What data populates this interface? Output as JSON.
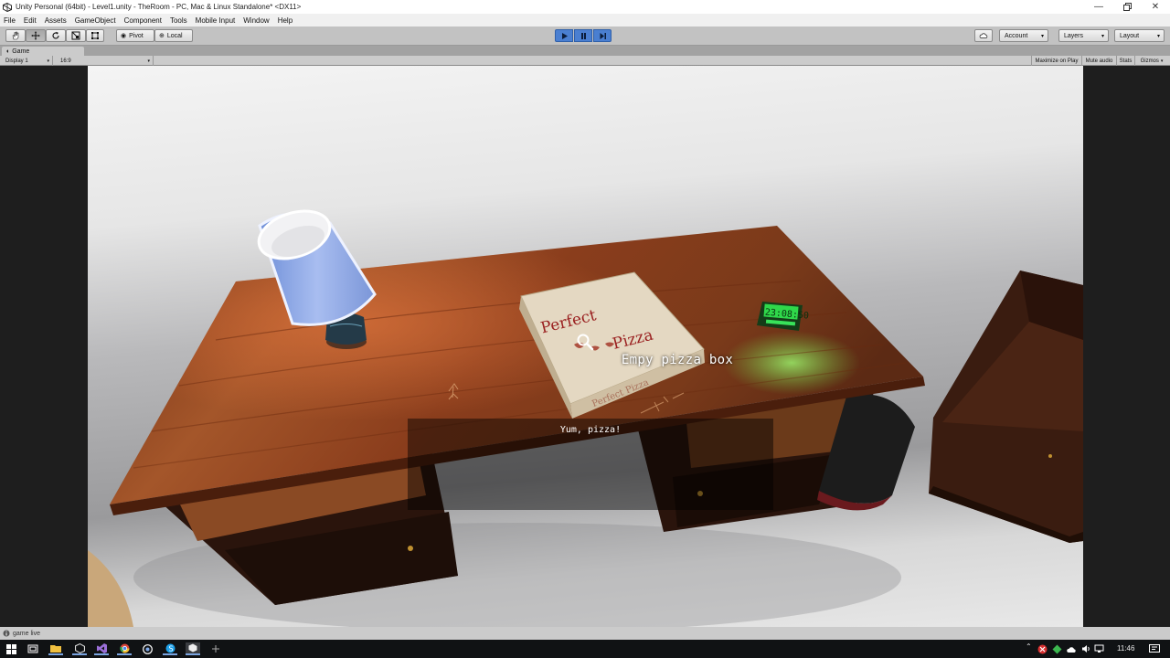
{
  "window": {
    "title": "Unity Personal (64bit) - Level1.unity - TheRoom - PC, Mac & Linux Standalone* <DX11>",
    "controls": [
      "minimize-icon",
      "restore-icon",
      "close-icon"
    ]
  },
  "menu": [
    "File",
    "Edit",
    "Assets",
    "GameObject",
    "Component",
    "Tools",
    "Mobile Input",
    "Window",
    "Help"
  ],
  "toolbar": {
    "tools": [
      "hand-tool-icon",
      "move-tool-icon",
      "rotate-tool-icon",
      "scale-tool-icon",
      "rect-tool-icon"
    ],
    "pivot_label": "Pivot",
    "local_label": "Local",
    "account_label": "Account",
    "layers_label": "Layers",
    "layout_label": "Layout"
  },
  "game_tab": {
    "label": "Game",
    "display": "Display 1",
    "aspect": "16:9",
    "maximize": "Maximize on Play",
    "mute": "Mute audio",
    "stats": "Stats",
    "gizmos": "Gizmos"
  },
  "scene": {
    "pizza_box_top": "Perfect",
    "pizza_box_bottom": "Pizza",
    "pizza_box_side": "Perfect Pizza",
    "clock_time": "23:08:50",
    "interaction_prompt": "Empy pizza box",
    "dialog_text": "Yum, pizza!"
  },
  "status": {
    "text": "game live"
  },
  "taskbar": {
    "time": "11:46"
  },
  "colors": {
    "play_active": "#4a7fd1",
    "clock_green": "#38e35a",
    "desk_wood": "#8a3d1c",
    "lamp_shade": "#8fa8e6"
  }
}
